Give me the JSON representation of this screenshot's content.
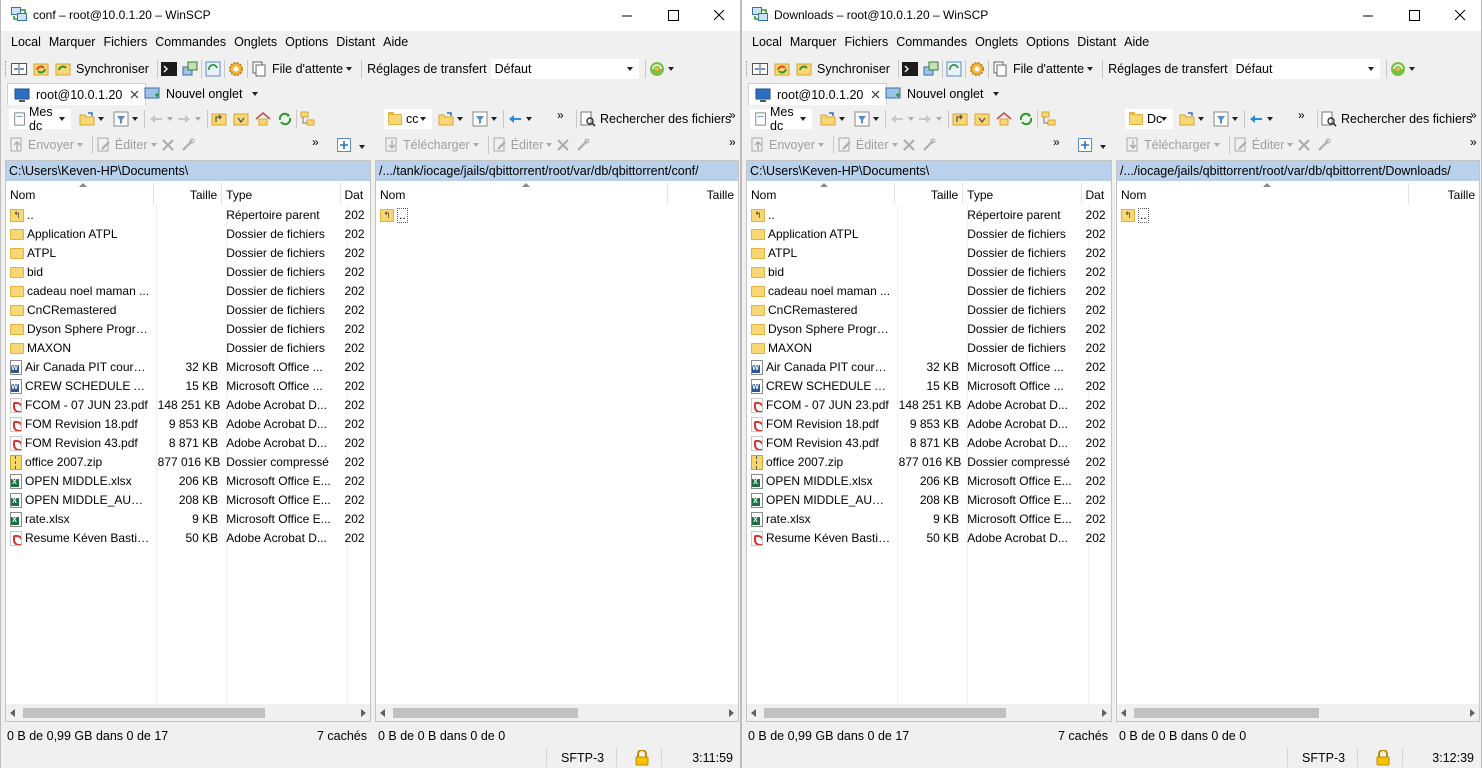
{
  "menu": [
    "Local",
    "Marquer",
    "Fichiers",
    "Commandes",
    "Onglets",
    "Options",
    "Distant",
    "Aide"
  ],
  "toolbar": {
    "sync": "Synchroniser",
    "queue": "File d'attente",
    "transfer_settings": "Réglages de transfert",
    "transfer_value": "Défaut"
  },
  "local_toolbar": {
    "send": "Envoyer",
    "edit": "Éditer"
  },
  "remote_toolbar": {
    "download": "Télécharger",
    "edit": "Éditer",
    "find": "Rechercher des fichiers"
  },
  "columns": {
    "name": "Nom",
    "size": "Taille",
    "type": "Type",
    "date": "Dat"
  },
  "local_files": [
    {
      "name": "..",
      "size": "",
      "type": "Répertoire parent",
      "date": "202",
      "icon": "up"
    },
    {
      "name": "Application ATPL",
      "size": "",
      "type": "Dossier de fichiers",
      "date": "202",
      "icon": "folder"
    },
    {
      "name": "ATPL",
      "size": "",
      "type": "Dossier de fichiers",
      "date": "202",
      "icon": "folder"
    },
    {
      "name": "bid",
      "size": "",
      "type": "Dossier de fichiers",
      "date": "202",
      "icon": "folder"
    },
    {
      "name": "cadeau noel maman ...",
      "size": "",
      "type": "Dossier de fichiers",
      "date": "202",
      "icon": "folder"
    },
    {
      "name": "CnCRemastered",
      "size": "",
      "type": "Dossier de fichiers",
      "date": "202",
      "icon": "folder"
    },
    {
      "name": "Dyson Sphere Program",
      "size": "",
      "type": "Dossier de fichiers",
      "date": "202",
      "icon": "folder"
    },
    {
      "name": "MAXON",
      "size": "",
      "type": "Dossier de fichiers",
      "date": "202",
      "icon": "folder"
    },
    {
      "name": "Air Canada PIT course...",
      "size": "32 KB",
      "type": "Microsoft Office ...",
      "date": "202",
      "icon": "word"
    },
    {
      "name": "CREW SCHEDULE AN...",
      "size": "15 KB",
      "type": "Microsoft Office ...",
      "date": "202",
      "icon": "word"
    },
    {
      "name": "FCOM - 07 JUN 23.pdf",
      "size": "148 251 KB",
      "type": "Adobe Acrobat D...",
      "date": "202",
      "icon": "pdf"
    },
    {
      "name": "FOM Revision 18.pdf",
      "size": "9 853 KB",
      "type": "Adobe Acrobat D...",
      "date": "202",
      "icon": "pdf"
    },
    {
      "name": "FOM Revision 43.pdf",
      "size": "8 871 KB",
      "type": "Adobe Acrobat D...",
      "date": "202",
      "icon": "pdf"
    },
    {
      "name": "office 2007.zip",
      "size": "877 016 KB",
      "type": "Dossier compressé",
      "date": "202",
      "icon": "zip"
    },
    {
      "name": "OPEN MIDDLE.xlsx",
      "size": "206 KB",
      "type": "Microsoft Office E...",
      "date": "202",
      "icon": "excel"
    },
    {
      "name": "OPEN MIDDLE_AUTO...",
      "size": "208 KB",
      "type": "Microsoft Office E...",
      "date": "202",
      "icon": "excel"
    },
    {
      "name": "rate.xlsx",
      "size": "9 KB",
      "type": "Microsoft Office E...",
      "date": "202",
      "icon": "excel"
    },
    {
      "name": "Resume Kéven Bastie...",
      "size": "50 KB",
      "type": "Adobe Acrobat D...",
      "date": "202",
      "icon": "pdf"
    }
  ],
  "windows": [
    {
      "title": "conf – root@10.0.1.20 – WinSCP",
      "session_tab": "root@10.0.1.20",
      "new_tab": "Nouvel onglet",
      "local_dir_combo": "Mes dc",
      "remote_dir_combo": "cc",
      "local_path": "C:\\Users\\Keven-HP\\Documents\\",
      "remote_path": "/.../tank/iocage/jails/qbittorrent/root/var/db/qbittorrent/conf/",
      "remote_parent": "..",
      "local_status": "0 B de 0,99 GB dans 0 de 17",
      "hidden": "7 cachés",
      "remote_status": "0 B de 0 B dans 0 de 0",
      "protocol": "SFTP-3",
      "time": "3:11:59"
    },
    {
      "title": "Downloads – root@10.0.1.20 – WinSCP",
      "session_tab": "root@10.0.1.20",
      "new_tab": "Nouvel onglet",
      "local_dir_combo": "Mes dc",
      "remote_dir_combo": "Dc",
      "local_path": "C:\\Users\\Keven-HP\\Documents\\",
      "remote_path": "/.../iocage/jails/qbittorrent/root/var/db/qbittorrent/Downloads/",
      "remote_parent": "..",
      "local_status": "0 B de 0,99 GB dans 0 de 17",
      "hidden": "7 cachés",
      "remote_status": "0 B de 0 B dans 0 de 0",
      "protocol": "SFTP-3",
      "time": "3:12:39"
    }
  ],
  "colors": {
    "path_bar": "#b9d1ea",
    "folder": "#f8d775",
    "background": "#f0f0f0"
  },
  "icons": [
    "winscp-app-icon",
    "minimize-icon",
    "maximize-icon",
    "close-icon",
    "compare-icon",
    "synchronize-icon",
    "console-icon",
    "gear-icon",
    "queue-icon",
    "transfer-settings-icon",
    "folder-icon",
    "filter-icon",
    "back-arrow-icon",
    "forward-arrow-icon",
    "parent-dir-icon",
    "root-dir-icon",
    "home-icon",
    "refresh-icon",
    "find-icon",
    "send-icon",
    "download-icon",
    "edit-icon",
    "delete-icon",
    "new-icon",
    "lock-icon"
  ]
}
